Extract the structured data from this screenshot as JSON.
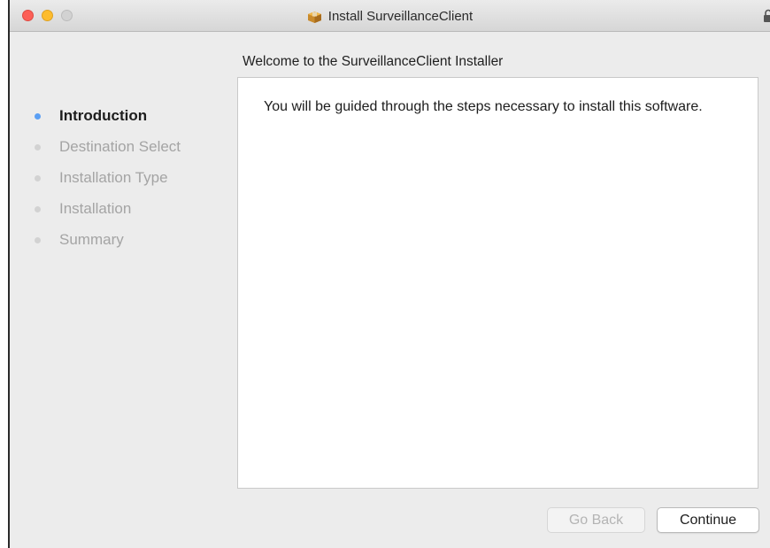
{
  "window": {
    "title": "Install SurveillanceClient",
    "title_icon": "package-icon",
    "lock_icon": "lock-icon"
  },
  "sidebar": {
    "steps": [
      {
        "label": "Introduction",
        "state": "active"
      },
      {
        "label": "Destination Select",
        "state": "inactive"
      },
      {
        "label": "Installation Type",
        "state": "inactive"
      },
      {
        "label": "Installation",
        "state": "inactive"
      },
      {
        "label": "Summary",
        "state": "inactive"
      }
    ]
  },
  "main": {
    "heading": "Welcome to the SurveillanceClient Installer",
    "body": "You will be guided through the steps necessary to install this software."
  },
  "buttons": {
    "back_label": "Go Back",
    "back_enabled": false,
    "continue_label": "Continue",
    "continue_enabled": true
  },
  "colors": {
    "active_step_dot": "#5a9ff4",
    "inactive_step_dot": "#d2d2d2",
    "close": "#fc5f57",
    "minimize": "#fdbc2e"
  }
}
